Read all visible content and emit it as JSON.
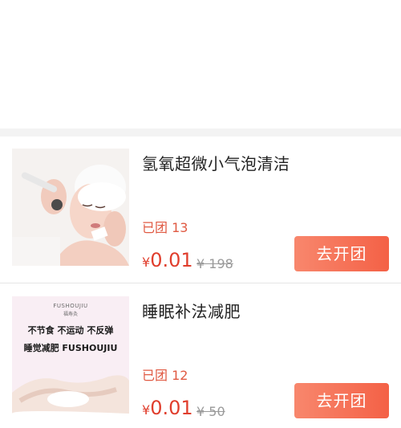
{
  "products": [
    {
      "title": "氢氧超微小气泡清洁",
      "group_label": "已团",
      "group_count": "13",
      "price_symbol": "¥",
      "price": "0.01",
      "original_price": "¥ 198",
      "button_label": "去开团",
      "image": "facial-treatment-photo"
    },
    {
      "title": "睡眠补法减肥",
      "group_label": "已团",
      "group_count": "12",
      "price_symbol": "¥",
      "price": "0.01",
      "original_price": "¥ 50",
      "button_label": "去开团",
      "image": "body-slimming-poster",
      "poster": {
        "brand": "FUSHOUJIU",
        "brand_cn": "福寿灸",
        "slogan": "不节食 不运动 不反弹",
        "tagline": "睡觉减肥 FUSHOUJIU"
      }
    }
  ],
  "colors": {
    "accent": "#e03e2d",
    "button_start": "#f8876d",
    "button_end": "#f46146",
    "muted": "#9a9a9a"
  }
}
